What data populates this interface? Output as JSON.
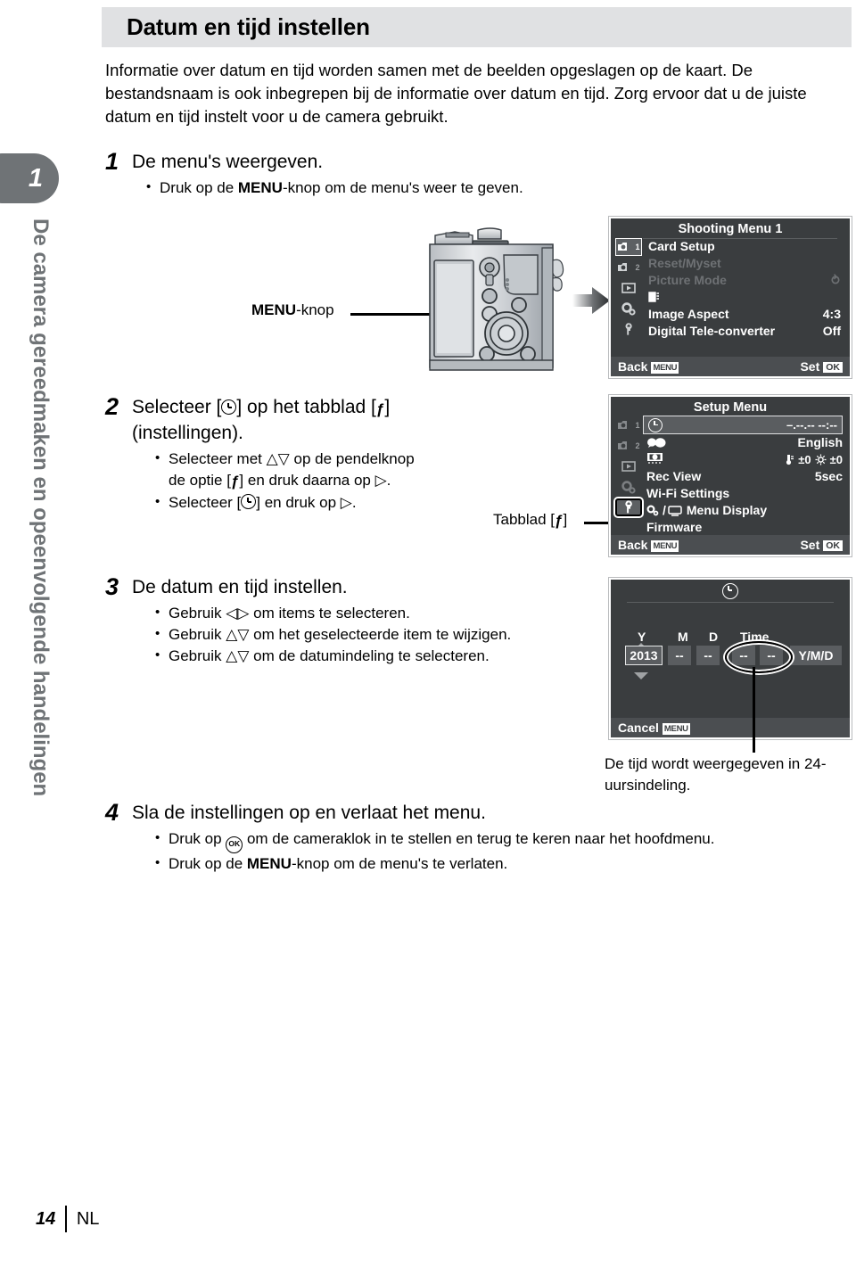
{
  "page": {
    "header_title": "Datum en tijd instellen",
    "footer_page": "14",
    "footer_lang": "NL",
    "chapter_number": "1",
    "chapter_title": "De camera gereedmaken en opeenvolgende handelingen"
  },
  "intro": "Informatie over datum en tijd worden samen met de beelden opgeslagen op de kaart. De bestandsnaam is ook inbegrepen bij de informatie over datum en tijd. Zorg ervoor dat u de juiste datum en tijd instelt voor u de camera gebruikt.",
  "steps": [
    {
      "num": "1",
      "title": "De menu's weergeven.",
      "bullets": [
        "Druk op de MENU-knop om de menu's weer te geven."
      ]
    },
    {
      "num": "2",
      "title_line1": "Selecteer [⊕] op het tabblad [ƒ]",
      "title_line2": "(instellingen).",
      "bullets": [
        "Selecteer met △▽ op de pendelknop de optie [ƒ] en druk daarna op ▷.",
        "Selecteer [⊕] en druk op ▷."
      ]
    },
    {
      "num": "3",
      "title": "De datum en tijd instellen.",
      "bullets": [
        "Gebruik ◁▷ om items te selecteren.",
        "Gebruik △▽ om het geselecteerde item te wijzigen.",
        "Gebruik △▽ om de datumindeling te selecteren."
      ]
    },
    {
      "num": "4",
      "title": "Sla de instellingen op en verlaat het menu.",
      "bullets": [
        "Druk op ⒪ om de cameraklok in te stellen en terug te keren naar het hoofdmenu.",
        "Druk op de MENU-knop om de menu's te verlaten."
      ]
    }
  ],
  "callouts": {
    "menu_button_label_bold": "MENU",
    "menu_button_label_rest": "-knop",
    "tab_label": "Tabblad [ƒ]",
    "note": "De tijd wordt weergegeven in 24-uursindeling."
  },
  "step_text": {
    "s1_title": "De menu's weergeven.",
    "s1_b1_pre": "Druk op de ",
    "s1_b1_bold": "MENU",
    "s1_b1_post": "-knop om de menu's weer te geven.",
    "s2_title_a": "Selecteer [",
    "s2_title_b": "] op het tabblad [",
    "s2_title_c": "]",
    "s2_title_line2": "(instellingen).",
    "s2_b1_a": "Selecteer met ",
    "s2_b1_b": " op de pendelknop",
    "s2_b1_c": "de optie [",
    "s2_b1_d": "] en druk daarna op ",
    "s2_b1_e": ".",
    "s2_b2_a": "Selecteer [",
    "s2_b2_b": "] en druk op ",
    "s2_b2_c": ".",
    "s3_title": "De datum en tijd instellen.",
    "s3_b1": "Gebruik ◁▷ om items te selecteren.",
    "s3_b2": "Gebruik △▽ om het geselecteerde item te wijzigen.",
    "s3_b3": "Gebruik △▽ om de datumindeling te selecteren.",
    "s4_title": "Sla de instellingen op en verlaat het menu.",
    "s4_b1_a": "Druk op ",
    "s4_b1_b": " om de cameraklok in te stellen en terug te keren naar het hoofdmenu.",
    "s4_b2_a": "Druk op de ",
    "s4_b2_bold": "MENU",
    "s4_b2_c": "-knop om de menu's te verlaten.",
    "arrow_ud": "△▽",
    "arrow_right": "▷",
    "ok_glyph": "OK"
  },
  "shooting_menu": {
    "title": "Shooting Menu 1",
    "tabs": [
      "cam1",
      "cam2",
      "play",
      "gears",
      "wrench"
    ],
    "tab_labels": [
      "1",
      "2",
      "▶",
      "⚙",
      "ƒ"
    ],
    "selected_tab_index": 0,
    "rows": [
      {
        "label": "Card Setup",
        "value": "",
        "dim": false
      },
      {
        "label": "Reset/Myset",
        "value": "",
        "dim": true
      },
      {
        "label": "Picture Mode",
        "value": "⥁",
        "dim": true
      },
      {
        "label": "❖",
        "value": "",
        "dim": false
      },
      {
        "label": "Image Aspect",
        "value": "4:3",
        "dim": false
      },
      {
        "label": "Digital Tele-converter",
        "value": "Off",
        "dim": false
      }
    ],
    "footer_left": "Back",
    "footer_left_chip": "MENU",
    "footer_right": "Set",
    "footer_right_chip": "OK"
  },
  "setup_menu": {
    "title": "Setup Menu",
    "tab_labels": [
      "1",
      "2",
      "▶",
      "⚙",
      "ƒ"
    ],
    "highlighted_tab_index": 4,
    "rows": [
      {
        "label": "clock-icon",
        "value": "–.--.-- --:--",
        "boxed": true
      },
      {
        "label": "☺●",
        "value": "English",
        "boxed": false
      },
      {
        "label": "▣",
        "value": "±0  ±0",
        "boxed": false
      },
      {
        "label": "Rec View",
        "value": "5sec",
        "boxed": false
      },
      {
        "label": "Wi-Fi Settings",
        "value": "",
        "boxed": false
      },
      {
        "label": "⚙/▭ Menu Display",
        "value": "",
        "boxed": false
      },
      {
        "label": "Firmware",
        "value": "",
        "boxed": false
      }
    ],
    "footer_left": "Back",
    "footer_left_chip": "MENU",
    "footer_right": "Set",
    "footer_right_chip": "OK"
  },
  "date_screen": {
    "title": "clock-icon",
    "column_labels": [
      "Y",
      "M",
      "D",
      "Time"
    ],
    "year_value": "2013",
    "month_value": "--",
    "day_value": "--",
    "hour_value": "--",
    "minute_value": "--",
    "format_value": "Y/M/D",
    "footer_left": "Cancel",
    "footer_left_chip": "MENU"
  },
  "colors": {
    "header_bg": "#e0e1e3",
    "chapter_gray": "#6f7376",
    "lcd_bg": "#3a3d3f",
    "lcd_footer": "#4b4e51",
    "lcd_dim": "#6e7174"
  }
}
